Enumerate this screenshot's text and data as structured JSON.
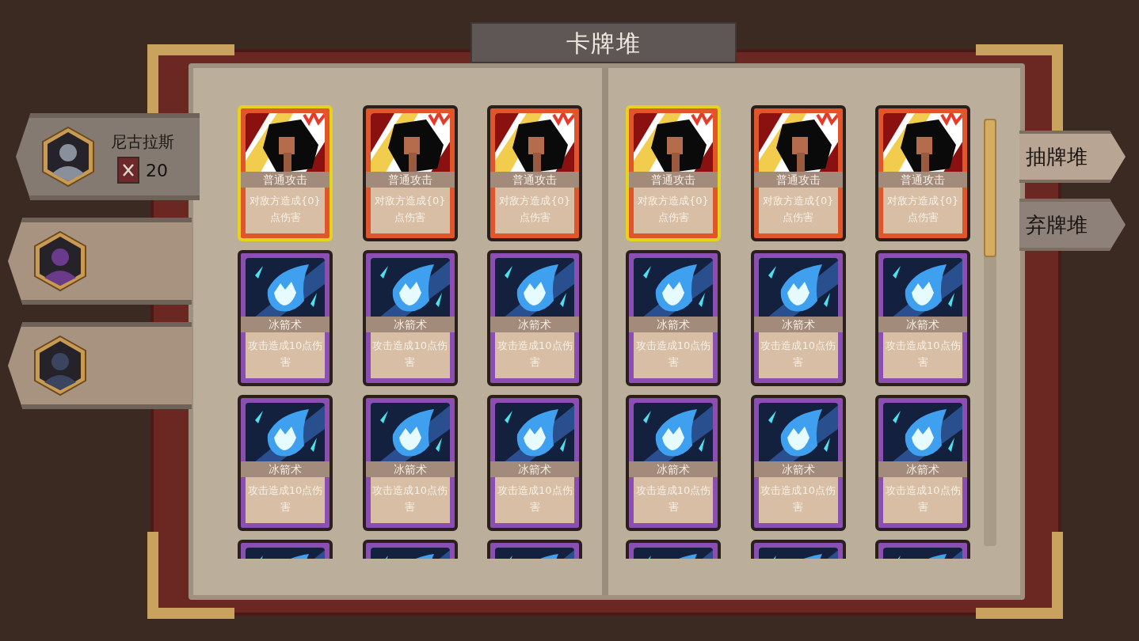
{
  "title": "卡牌堆",
  "characters": [
    {
      "name": "尼古拉斯",
      "count": "20",
      "selected": true
    },
    {
      "selected": false
    },
    {
      "selected": false
    }
  ],
  "piles": [
    {
      "label": "抽牌堆",
      "selected": true
    },
    {
      "label": "弃牌堆",
      "selected": false
    }
  ],
  "pages": [
    {
      "cards": [
        {
          "kind": "attack",
          "name": "普通攻击",
          "description": "对敌方造成{0}点伤害",
          "selected": true
        },
        {
          "kind": "attack",
          "name": "普通攻击",
          "description": "对敌方造成{0}点伤害",
          "selected": false
        },
        {
          "kind": "attack",
          "name": "普通攻击",
          "description": "对敌方造成{0}点伤害",
          "selected": false
        },
        {
          "kind": "ice",
          "name": "冰箭术",
          "description": "攻击造成10点伤害",
          "selected": false
        },
        {
          "kind": "ice",
          "name": "冰箭术",
          "description": "攻击造成10点伤害",
          "selected": false
        },
        {
          "kind": "ice",
          "name": "冰箭术",
          "description": "攻击造成10点伤害",
          "selected": false
        },
        {
          "kind": "ice",
          "name": "冰箭术",
          "description": "攻击造成10点伤害",
          "selected": false
        },
        {
          "kind": "ice",
          "name": "冰箭术",
          "description": "攻击造成10点伤害",
          "selected": false
        },
        {
          "kind": "ice",
          "name": "冰箭术",
          "description": "攻击造成10点伤害",
          "selected": false
        },
        {
          "kind": "ice",
          "selected": false
        },
        {
          "kind": "ice",
          "selected": false
        },
        {
          "kind": "ice",
          "selected": false
        }
      ]
    },
    {
      "cards": [
        {
          "kind": "attack",
          "name": "普通攻击",
          "description": "对敌方造成{0}点伤害",
          "selected": true
        },
        {
          "kind": "attack",
          "name": "普通攻击",
          "description": "对敌方造成{0}点伤害",
          "selected": false
        },
        {
          "kind": "attack",
          "name": "普通攻击",
          "description": "对敌方造成{0}点伤害",
          "selected": false
        },
        {
          "kind": "ice",
          "name": "冰箭术",
          "description": "攻击造成10点伤害",
          "selected": false
        },
        {
          "kind": "ice",
          "name": "冰箭术",
          "description": "攻击造成10点伤害",
          "selected": false
        },
        {
          "kind": "ice",
          "name": "冰箭术",
          "description": "攻击造成10点伤害",
          "selected": false
        },
        {
          "kind": "ice",
          "name": "冰箭术",
          "description": "攻击造成10点伤害",
          "selected": false
        },
        {
          "kind": "ice",
          "name": "冰箭术",
          "description": "攻击造成10点伤害",
          "selected": false
        },
        {
          "kind": "ice",
          "name": "冰箭术",
          "description": "攻击造成10点伤害",
          "selected": false
        },
        {
          "kind": "ice",
          "selected": false
        },
        {
          "kind": "ice",
          "selected": false
        },
        {
          "kind": "ice",
          "selected": false
        }
      ]
    }
  ]
}
